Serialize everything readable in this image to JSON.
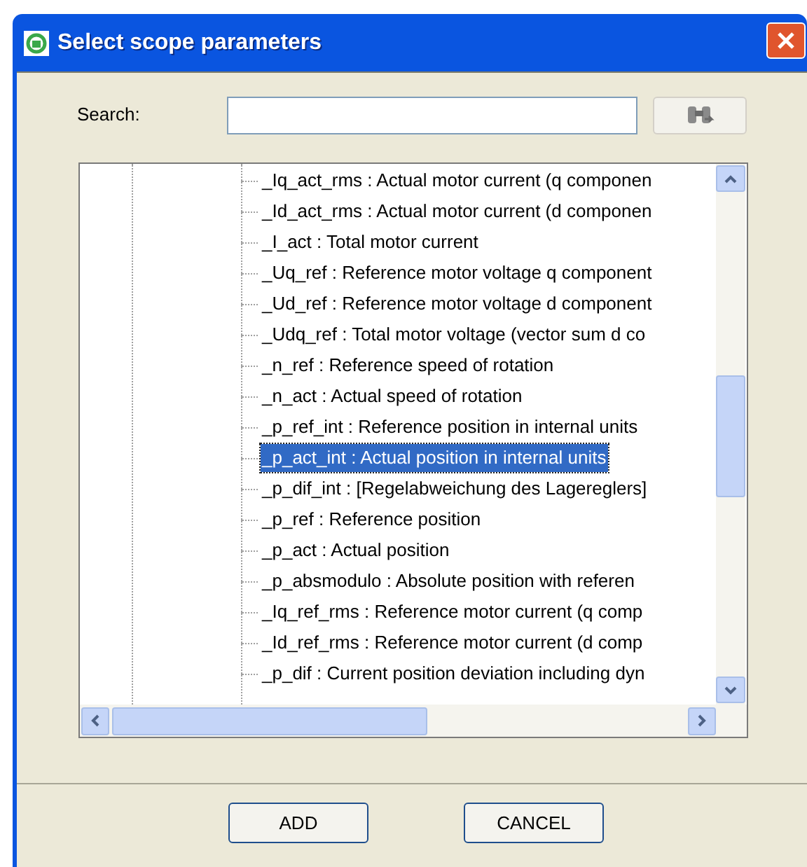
{
  "window": {
    "title": "Select scope parameters"
  },
  "search": {
    "label": "Search:"
  },
  "tree": {
    "items": [
      {
        "label": "_Iq_act_rms : Actual motor current (q componen",
        "selected": false
      },
      {
        "label": "_Id_act_rms : Actual motor current (d componen",
        "selected": false
      },
      {
        "label": "_I_act : Total motor current",
        "selected": false
      },
      {
        "label": "_Uq_ref : Reference motor voltage q component",
        "selected": false
      },
      {
        "label": "_Ud_ref : Reference motor voltage d component",
        "selected": false
      },
      {
        "label": "_Udq_ref : Total motor voltage (vector sum d co",
        "selected": false
      },
      {
        "label": "_n_ref : Reference speed of rotation",
        "selected": false
      },
      {
        "label": "_n_act : Actual speed of rotation",
        "selected": false
      },
      {
        "label": "_p_ref_int : Reference position in internal units",
        "selected": false
      },
      {
        "label": "_p_act_int : Actual position in internal units",
        "selected": true
      },
      {
        "label": "_p_dif_int : [Regelabweichung des Lagereglers]",
        "selected": false
      },
      {
        "label": "_p_ref : Reference position",
        "selected": false
      },
      {
        "label": "_p_act : Actual position",
        "selected": false
      },
      {
        "label": "_p_absmodulo : Absolute position with referen",
        "selected": false
      },
      {
        "label": "_Iq_ref_rms : Reference motor current (q comp",
        "selected": false
      },
      {
        "label": "_Id_ref_rms : Reference motor current (d comp",
        "selected": false
      },
      {
        "label": "_p_dif : Current position deviation including dyn",
        "selected": false
      }
    ]
  },
  "buttons": [
    "ADD",
    "CANCEL"
  ]
}
